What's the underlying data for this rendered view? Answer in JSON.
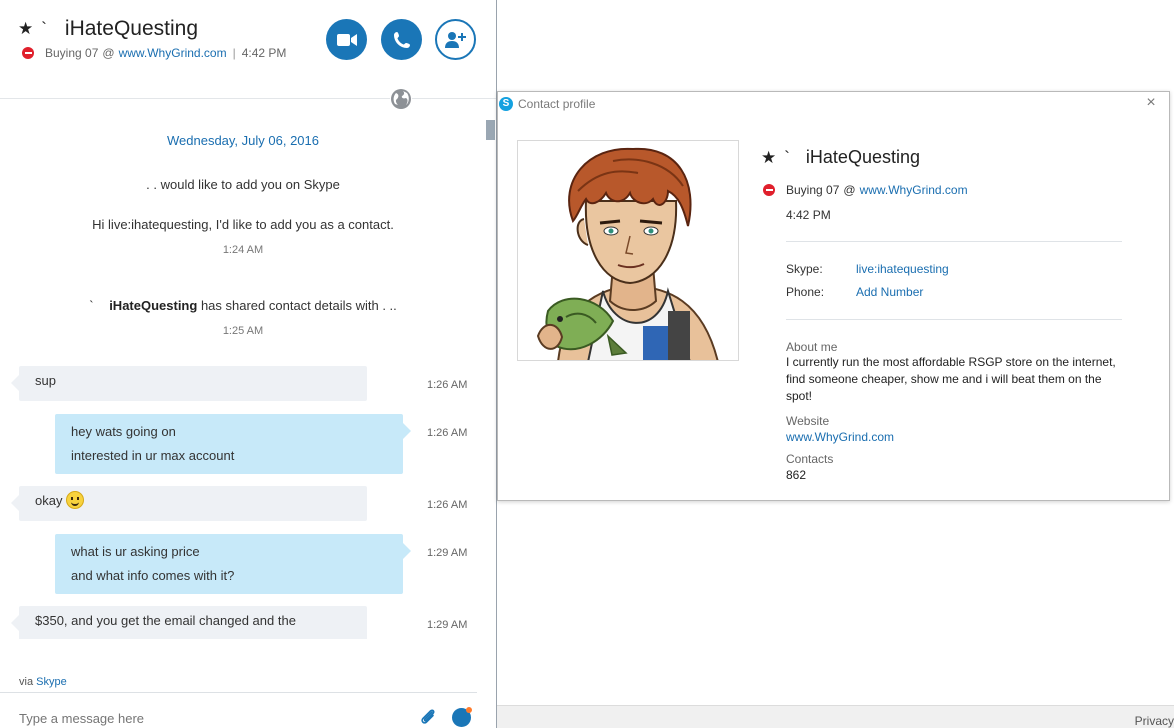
{
  "header": {
    "name": "iHateQuesting",
    "status_prefix": "Buying 07",
    "status_at": "@",
    "status_link": "www.WhyGrind.com",
    "status_sep": "|",
    "status_time": "4:42 PM"
  },
  "chat": {
    "date": "Wednesday, July 06, 2016",
    "system": [
      {
        "text": ". . would like to add you on Skype"
      },
      {
        "text": "Hi live:ihatequesting, I'd like to add you as a contact.",
        "time": "1:24 AM"
      },
      {
        "text_prefix": "`",
        "text_name": "iHateQuesting",
        "text_suffix": "has shared contact details with . ..",
        "time": "1:25 AM"
      }
    ],
    "messages": [
      {
        "lines": [
          "sup"
        ],
        "time": "1:26 AM"
      },
      {
        "lines": [
          "hey wats going on",
          "interested in ur max account"
        ],
        "time": "1:26 AM"
      },
      {
        "lines": [
          "okay"
        ],
        "time": "1:26 AM"
      },
      {
        "lines": [
          "what is ur asking price",
          "and what info comes with it?"
        ],
        "time": "1:29 AM"
      },
      {
        "lines": [
          "$350, and you get the email changed and the"
        ],
        "time": "1:29 AM"
      }
    ],
    "via_prefix": "via",
    "via_link": "Skype",
    "compose_placeholder": "Type a message here"
  },
  "profile": {
    "window_title": "Contact profile",
    "close": "×",
    "name": "iHateQuesting",
    "status_prefix": "Buying 07",
    "status_at": "@",
    "status_link": "www.WhyGrind.com",
    "time": "4:42 PM",
    "skype_label": "Skype:",
    "skype_value": "live:ihatequesting",
    "phone_label": "Phone:",
    "phone_value": "Add Number",
    "about_label": "About me",
    "about_text": "I currently run the most affordable RSGP store on the internet, find someone cheaper, show me and i will beat them on the spot!",
    "website_label": "Website",
    "website_value": "www.WhyGrind.com",
    "contacts_label": "Contacts",
    "contacts_value": "862"
  },
  "footer": {
    "privacy": "Privacy"
  },
  "colors": {
    "accent": "#1a76b7",
    "link": "#1a6eb0",
    "incoming": "#eef1f5",
    "outgoing": "#c7e9f9",
    "dnd": "#e0202c"
  },
  "icons": [
    "favorite-star-icon",
    "do-not-disturb-icon",
    "video-call-icon",
    "phone-call-icon",
    "add-contact-icon",
    "globe-icon",
    "smiley-emoji-icon",
    "attach-paperclip-icon",
    "emoticon-icon",
    "skype-logo-icon",
    "close-icon"
  ]
}
